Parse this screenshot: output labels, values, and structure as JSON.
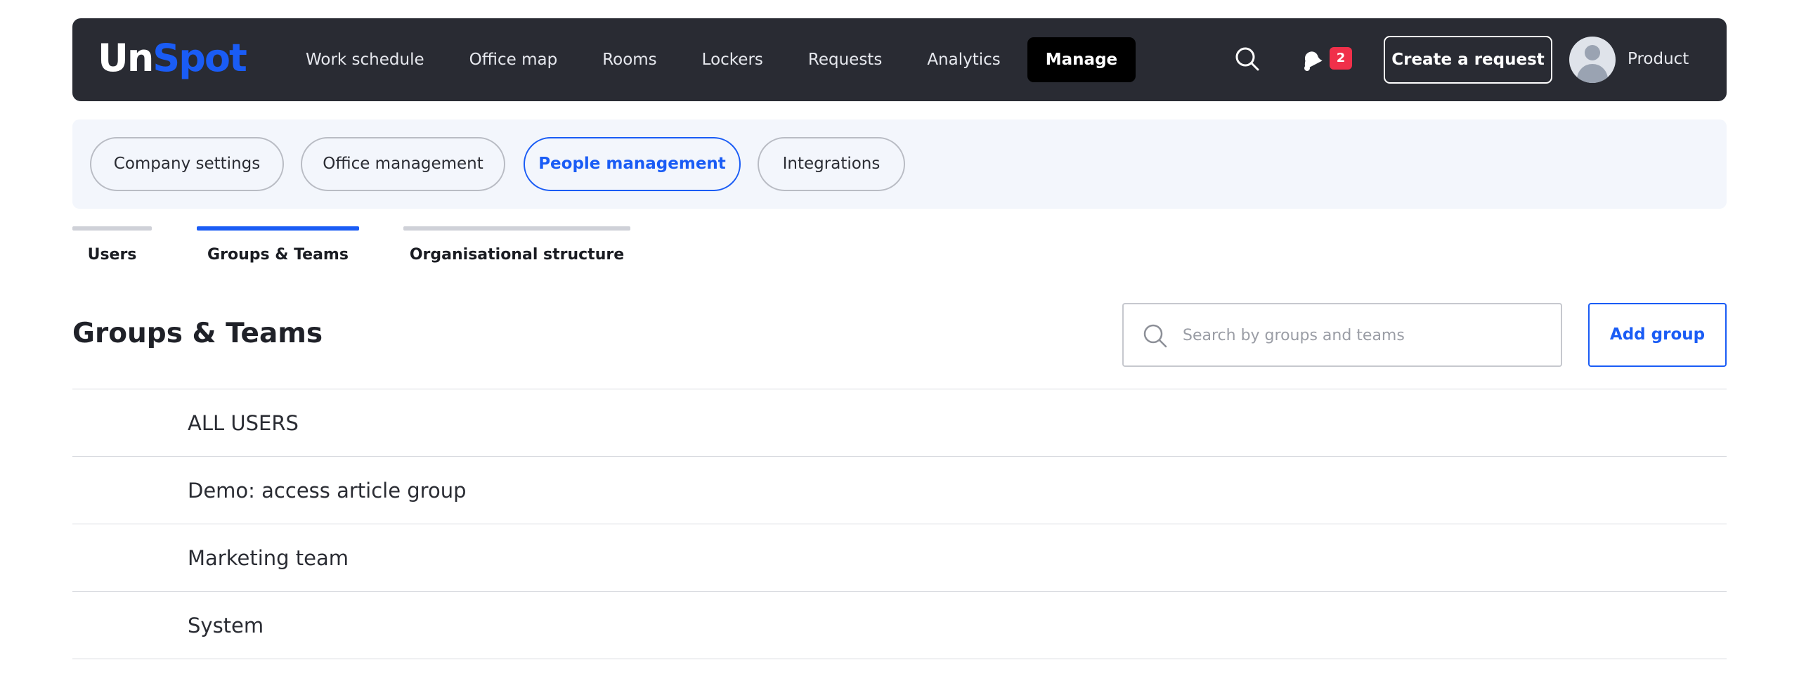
{
  "header": {
    "logo": {
      "part1": "Un",
      "part2": "Spot"
    },
    "nav": [
      {
        "label": "Work schedule"
      },
      {
        "label": "Office map"
      },
      {
        "label": "Rooms"
      },
      {
        "label": "Lockers"
      },
      {
        "label": "Requests"
      },
      {
        "label": "Analytics"
      },
      {
        "label": "Manage",
        "active": true
      }
    ],
    "notifications_count": "2",
    "create_request_label": "Create a request",
    "user_name": "Product"
  },
  "management_tabs": [
    {
      "label": "Company settings"
    },
    {
      "label": "Office management"
    },
    {
      "label": "People management",
      "active": true
    },
    {
      "label": "Integrations"
    }
  ],
  "sub_tabs": [
    {
      "label": "Users"
    },
    {
      "label": "Groups & Teams",
      "active": true
    },
    {
      "label": "Organisational structure"
    }
  ],
  "page": {
    "title": "Groups & Teams",
    "search_placeholder": "Search by groups and teams",
    "add_group_label": "Add group"
  },
  "groups": [
    {
      "name": "ALL USERS"
    },
    {
      "name": "Demo: access article group"
    },
    {
      "name": "Marketing team"
    },
    {
      "name": "System"
    }
  ],
  "colors": {
    "accent": "#1a5cf5",
    "topbar": "#292b33",
    "badge": "#f0304a",
    "pillbar_bg": "#f3f6fc"
  }
}
